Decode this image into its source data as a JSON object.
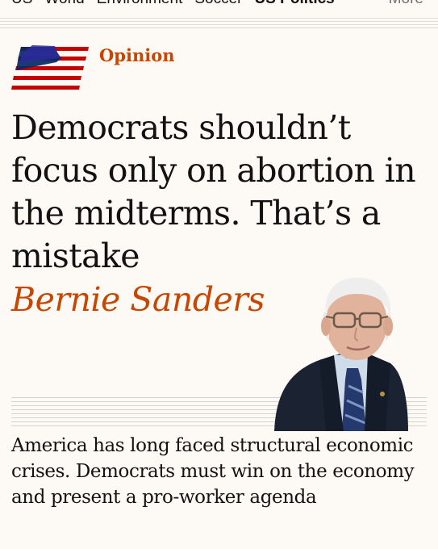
{
  "nav": {
    "items": [
      "US",
      "World",
      "Environment",
      "Soccer",
      "US Politics"
    ],
    "active_index": 4,
    "more_label": "More"
  },
  "section": {
    "kicker": "Opinion",
    "flag_icon": "us-flag-icon"
  },
  "article": {
    "headline": "Democrats shouldn’t focus only on abortion in the midterms. That’s a mistake",
    "author": "Bernie Sanders",
    "standfirst": "America has long faced structural economic crises. Democrats must win on the economy and present a pro-worker agenda"
  },
  "colors": {
    "accent": "#c74600",
    "background": "#fdf9f4",
    "flag_red": "#c70000",
    "flag_blue": "#052962"
  }
}
